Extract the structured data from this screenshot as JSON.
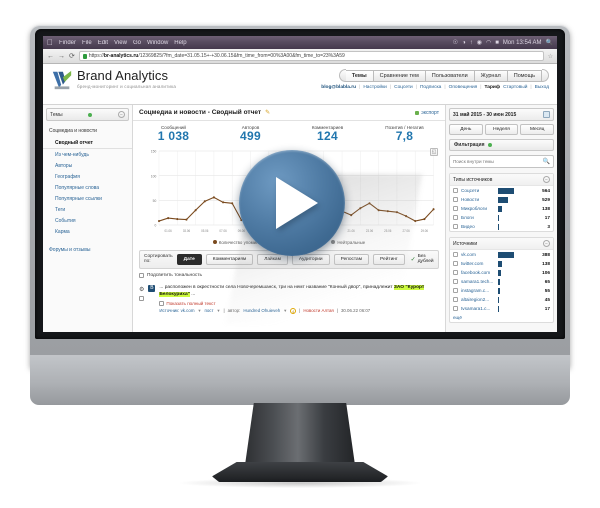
{
  "os_menubar": {
    "apple": "apple-logo",
    "items": [
      "Finder",
      "File",
      "Edit",
      "View",
      "Go",
      "Window",
      "Help"
    ],
    "status": [
      "☉",
      "◑",
      "↑",
      "◉",
      "◠",
      "■"
    ],
    "clock": "Mon 13:54 AM",
    "spotlight": "search-icon"
  },
  "browser": {
    "back": "←",
    "forward": "→",
    "reload": "⟳",
    "lock": "lock-icon",
    "url_prefix": "https://",
    "url_domain": "br-analytics.ru",
    "url_path": "/12369825/?fm_date=31.05.15+-+30.06.15&fm_time_from=00%3A00&fm_time_to=23%3A59",
    "star": "☆"
  },
  "app": {
    "brand_name": "Brand Analytics",
    "brand_tagline": "бренд-мониторинг и социальная аналитика",
    "nav": [
      {
        "label": "Темы",
        "active": true
      },
      {
        "label": "Сравнение тем",
        "active": false
      },
      {
        "label": "Пользователи",
        "active": false
      },
      {
        "label": "Журнал",
        "active": false
      },
      {
        "label": "Помощь",
        "active": false
      }
    ],
    "user_email": "blog@blabla.ru",
    "user_links": [
      "Настройки",
      "Соцсети",
      "Подписка",
      "Оповещения"
    ],
    "plan_label": "Тариф",
    "plan_value": "Стартовый",
    "logout": "Выход"
  },
  "sidebar": {
    "themes_label": "Темы",
    "group_title": "Соцмедиа и новости",
    "items": [
      {
        "label": "Сводный отчет",
        "active": true
      },
      {
        "label": "Из чем-нибудь",
        "active": false
      },
      {
        "label": "Авторы",
        "active": false
      },
      {
        "label": "География",
        "active": false
      },
      {
        "label": "Популярные слова",
        "active": false
      },
      {
        "label": "Популярные ссылки",
        "active": false
      },
      {
        "label": "Теги",
        "active": false
      },
      {
        "label": "События",
        "active": false
      },
      {
        "label": "Карма",
        "active": false
      }
    ],
    "forums_label": "Форумы и отзывы"
  },
  "report": {
    "title": "Соцмедиа и новости - Сводный отчет",
    "edit_icon": "pencil-icon",
    "export_label": "экспорт",
    "metrics": [
      {
        "label": "Сообщений",
        "value": "1 038"
      },
      {
        "label": "Авторов",
        "value": "499"
      },
      {
        "label": "Комментариев",
        "value": "124"
      },
      {
        "label": "Позитив / Негатив",
        "value": "7,8"
      }
    ]
  },
  "chart_data": {
    "type": "line",
    "title": "",
    "xlabel": "",
    "ylabel": "",
    "ylim": [
      0,
      150
    ],
    "yticks": [
      0,
      50,
      100,
      150
    ],
    "grid": true,
    "legend_position": "bottom",
    "x": [
      "31.05",
      "01.06",
      "02.06",
      "03.06",
      "04.06",
      "05.06",
      "06.06",
      "07.06",
      "08.06",
      "09.06",
      "10.06",
      "11.06",
      "12.06",
      "13.06",
      "14.06",
      "15.06",
      "16.06",
      "17.06",
      "18.06",
      "19.06",
      "20.06",
      "21.06",
      "22.06",
      "23.06",
      "24.06",
      "25.06",
      "26.06",
      "27.06",
      "28.06",
      "29.06",
      "30.06"
    ],
    "xticks_shown": [
      "01.06",
      "03.06",
      "05.06",
      "07.06",
      "09.06",
      "11.06",
      "13.06",
      "15.06",
      "17.06",
      "19.06",
      "21.06",
      "23.06",
      "25.06",
      "27.06",
      "29.06"
    ],
    "series": [
      {
        "name": "Количество упоминаний",
        "color": "#7a4a1e",
        "values": [
          8,
          14,
          12,
          11,
          30,
          48,
          56,
          46,
          44,
          10,
          14,
          16,
          112,
          44,
          32,
          30,
          28,
          26,
          34,
          30,
          28,
          20,
          34,
          44,
          30,
          28,
          26,
          18,
          8,
          12,
          32
        ]
      }
    ],
    "legend": [
      {
        "label": "Количество упоминаний",
        "color": "#7a4a1e"
      },
      {
        "label": "Позитив",
        "color": "#3a7d3a"
      },
      {
        "label": "Негатив",
        "color": "#b03a3a"
      },
      {
        "label": "Нейтральные",
        "color": "#8a8a8a"
      }
    ],
    "fullscreen_icon": "expand-icon"
  },
  "sort_toolbar": {
    "label": "Сортировать по:",
    "buttons": [
      {
        "label": "Дате",
        "active": true
      },
      {
        "label": "Комментариям",
        "active": false
      },
      {
        "label": "Лайкам",
        "active": false
      },
      {
        "label": "Аудитории",
        "active": false
      },
      {
        "label": "Репостам",
        "active": false
      },
      {
        "label": "Рейтинг",
        "active": false
      }
    ],
    "nodup_label": "Без дублей",
    "highlight_label": "Подсветить тональность"
  },
  "post": {
    "source_badge": "B",
    "text_before": "... расположен в окрестности села Новочеремшанск, три на немт название \"Конный двор\", принадлежит ",
    "highlight_1": "ЗАО \"Курорт",
    "highlight_2": "Белокуриха\"",
    "text_after": " ...",
    "fulltext_label": "Показать полный текст",
    "meta_source": "Источник: vk.com",
    "meta_post": "пост",
    "meta_author_label": "автор:",
    "meta_author": "Hundred Ohuieveh",
    "meta_rating": "4",
    "meta_category": "Новости Алтая",
    "meta_date": "30.06.22 06:07"
  },
  "filters": {
    "date_range": "31 май 2015 - 30 июн 2015",
    "calendar_icon": "calendar-icon",
    "periods": [
      "День",
      "Неделя",
      "Месяц"
    ],
    "filter_label": "Фильтрация",
    "search_placeholder": "Поиск внутри темы",
    "search_value": "",
    "facets": [
      {
        "title": "Типы источников",
        "rows": [
          {
            "label": "Соцсети",
            "value": "564",
            "pct": 100
          },
          {
            "label": "Новости",
            "value": "529",
            "pct": 60
          },
          {
            "label": "Микроблоги",
            "value": "138",
            "pct": 22
          },
          {
            "label": "Блоги",
            "value": "17",
            "pct": 4
          },
          {
            "label": "Видео",
            "value": "3",
            "pct": 3
          }
        ]
      },
      {
        "title": "Источники",
        "rows": [
          {
            "label": "vk.com",
            "value": "388",
            "pct": 100
          },
          {
            "label": "twitter.com",
            "value": "138",
            "pct": 26
          },
          {
            "label": "facebook.com",
            "value": "106",
            "pct": 20
          },
          {
            "label": "samara1.tech...",
            "value": "65",
            "pct": 13
          },
          {
            "label": "instagram.c...",
            "value": "55",
            "pct": 11
          },
          {
            "label": "altairegion2...",
            "value": "45",
            "pct": 9
          },
          {
            "label": "tvsamara1.c...",
            "value": "17",
            "pct": 5
          }
        ]
      }
    ],
    "more_label": "ещё"
  },
  "video": {
    "play_icon": "play-icon",
    "accent_color": "#4f7ba4"
  }
}
